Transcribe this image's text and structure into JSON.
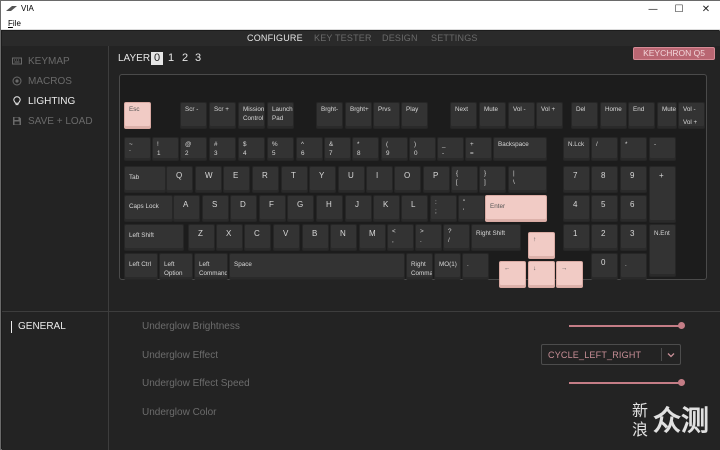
{
  "window": {
    "title": "VIA",
    "menu_file": "File",
    "minimize_glyph": "—",
    "maximize_glyph": "☐",
    "close_glyph": "✕"
  },
  "nav": {
    "tabs": [
      "CONFIGURE",
      "KEY TESTER",
      "DESIGN",
      "SETTINGS"
    ],
    "active": "CONFIGURE"
  },
  "sidebar": {
    "items": [
      {
        "label": "KEYMAP",
        "icon": "keyboard-icon"
      },
      {
        "label": "MACROS",
        "icon": "circle-dot-icon"
      },
      {
        "label": "LIGHTING",
        "icon": "lightbulb-icon"
      },
      {
        "label": "SAVE + LOAD",
        "icon": "save-icon"
      }
    ],
    "active": "LIGHTING"
  },
  "layer": {
    "label": "LAYER",
    "options": [
      "0",
      "1",
      "2",
      "3"
    ],
    "selected": "0"
  },
  "keyboard_name": "KEYCHRON Q5",
  "keys": {
    "esc": "Esc",
    "scr_minus": "Scr -",
    "scr_plus": "Scr +",
    "mission": [
      "Mission",
      "Control"
    ],
    "launch": [
      "Launch",
      "Pad"
    ],
    "bright_minus": "Brght-",
    "bright_plus": "Brght+",
    "prvs": "Prvs",
    "play": "Play",
    "next": "Next",
    "mute": "Mute",
    "vol_minus": "Vol -",
    "vol_plus": "Vol +",
    "del": "Del",
    "home": "Home",
    "end": "End",
    "mute2": "Mute",
    "vol_minus2": "Vol -",
    "vol_plus2": "Vol +",
    "tilde": [
      "~",
      "`"
    ],
    "n1": [
      "!",
      "1"
    ],
    "n2": [
      "@",
      "2"
    ],
    "n3": [
      "#",
      "3"
    ],
    "n4": [
      "$",
      "4"
    ],
    "n5": [
      "%",
      "5"
    ],
    "n6": [
      "^",
      "6"
    ],
    "n7": [
      "&",
      "7"
    ],
    "n8": [
      "*",
      "8"
    ],
    "n9": [
      "(",
      "9"
    ],
    "n0": [
      ")",
      "0"
    ],
    "minus": [
      "_",
      "-"
    ],
    "equal": [
      "+",
      "="
    ],
    "backspace": "Backspace",
    "nlck": "N.Lck",
    "slash_np": "/",
    "star_np": "*",
    "minus_np": "-",
    "tab": "Tab",
    "q": "Q",
    "w": "W",
    "e": "E",
    "r": "R",
    "t": "T",
    "y": "Y",
    "u": "U",
    "i": "I",
    "o": "O",
    "p": "P",
    "lbracket": [
      "{",
      "["
    ],
    "rbracket": [
      "}",
      "]"
    ],
    "backslash": [
      "|",
      "\\"
    ],
    "np7": "7",
    "np8": "8",
    "np9": "9",
    "np_plus": "+",
    "caps": "Caps Lock",
    "a": "A",
    "s": "S",
    "d": "D",
    "f": "F",
    "g": "G",
    "h": "H",
    "j": "J",
    "k": "K",
    "l": "L",
    "semicolon": [
      ":",
      ";"
    ],
    "quote": [
      "\"",
      "'"
    ],
    "enter": "Enter",
    "np4": "4",
    "np5": "5",
    "np6": "6",
    "lshift": "Left Shift",
    "z": "Z",
    "x": "X",
    "c": "C",
    "v": "V",
    "b": "B",
    "n": "N",
    "m": "M",
    "comma": [
      "<",
      ","
    ],
    "period": [
      ">",
      "."
    ],
    "slash": [
      "?",
      "/"
    ],
    "rshift": "Right Shift",
    "up": "↑",
    "np1": "1",
    "np2": "2",
    "np3": "3",
    "np_enter": "N.Ent",
    "lctrl": "Left Ctrl",
    "loption": [
      "Left",
      "Option"
    ],
    "lcommand": [
      "Left",
      "Command"
    ],
    "space": "Space",
    "rcommand": [
      "Right",
      "Comma"
    ],
    "mo1": "MO(1)",
    "dot_key": ".",
    "left": "←",
    "down": "↓",
    "right": "→",
    "np0": "0",
    "np_dot": "."
  },
  "lighting": {
    "section": "GENERAL",
    "brightness_label": "Underglow Brightness",
    "brightness_value": 1.0,
    "effect_label": "Underglow Effect",
    "effect_value": "CYCLE_LEFT_RIGHT",
    "speed_label": "Underglow Effect Speed",
    "speed_value": 1.0,
    "color_label": "Underglow Color"
  },
  "watermark": {
    "line1": "新",
    "line2": "浪",
    "logo": "众测"
  },
  "colors": {
    "accent": "#c47d86",
    "badge": "#b96672",
    "key_highlight": "#f1cbc5",
    "key": "#333333",
    "background": "#232323"
  }
}
